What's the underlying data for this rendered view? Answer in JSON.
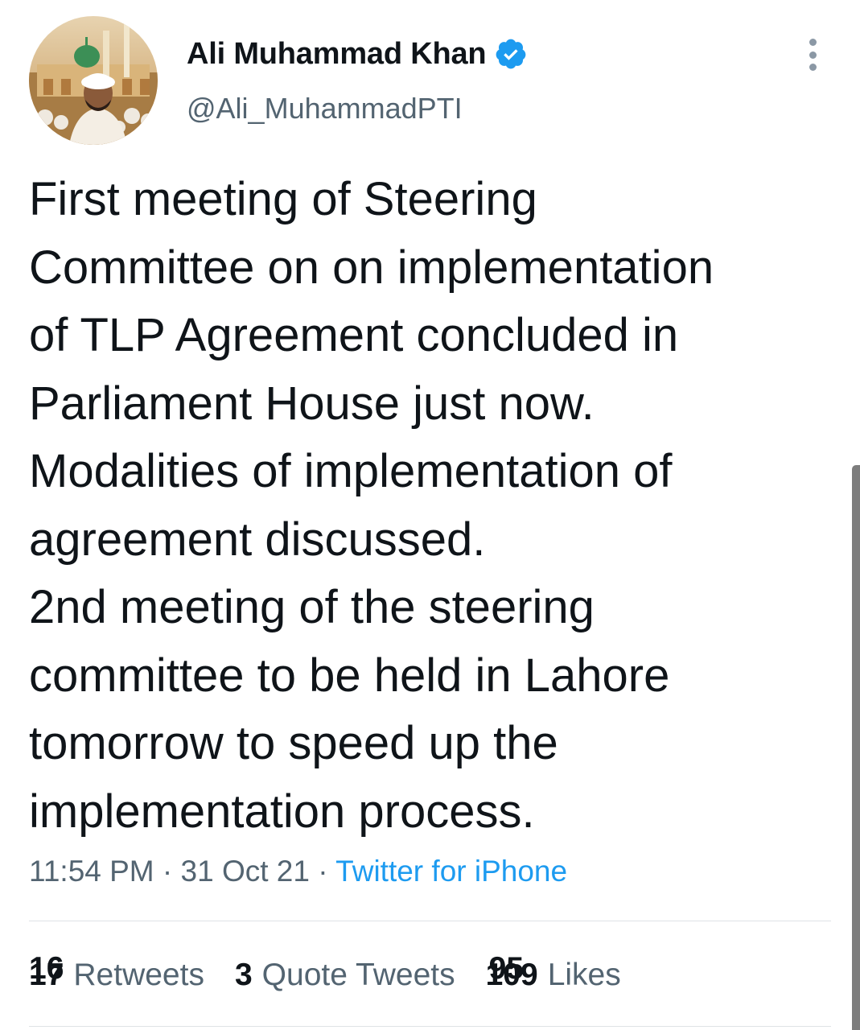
{
  "author": {
    "display_name": "Ali Muhammad Khan",
    "handle": "@Ali_MuhammadPTI",
    "verified": true,
    "avatar_icon": "profile-photo-icon"
  },
  "tweet": {
    "text": "First meeting of Steering\nCommittee on on implementation\nof TLP Agreement concluded in\nParliament House just now.\nModalities of implementation of\nagreement discussed.\n2nd meeting of the steering\ncommittee to be held in Lahore\ntomorrow to speed up the\nimplementation process."
  },
  "meta": {
    "time": "11:54 PM",
    "separator": " · ",
    "date": "31 Oct 21",
    "source": "Twitter for iPhone"
  },
  "stats": {
    "retweets_count_a": "16",
    "retweets_count_b": "17",
    "retweets_label": "Retweets",
    "quote_count": "3",
    "quote_label": "Quote Tweets",
    "likes_count_a": "95",
    "likes_count_b": "109",
    "likes_label": "Likes"
  },
  "colors": {
    "accent": "#1d9bf0",
    "text_primary": "#0f1419",
    "text_secondary": "#536471"
  },
  "icons": {
    "verified": "verified-badge-icon",
    "more": "more-options-icon"
  }
}
